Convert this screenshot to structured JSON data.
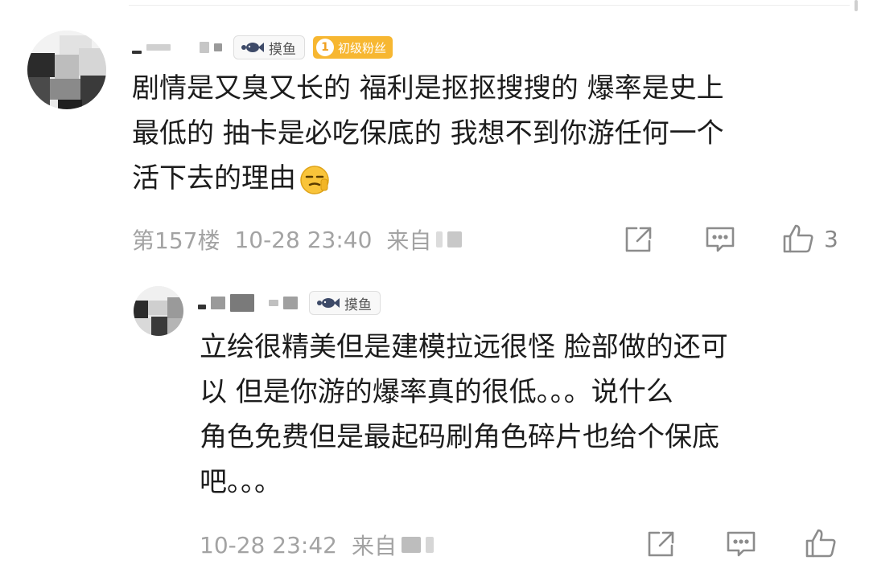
{
  "comments": [
    {
      "badges": {
        "fish_label": "摸鱼",
        "fan_level_icon": "1",
        "fan_label": "初级粉丝"
      },
      "text_lines": [
        "剧情是又臭又长的 福利是抠抠搜搜的 爆率是史上",
        "最低的 抽卡是必吃保底的 我想不到你游任何一个",
        "活下去的理由"
      ],
      "emoji": "squinting-face-emoji",
      "floor": "第157楼",
      "time": "10-28 23:40",
      "from_label": "来自",
      "like_count": "3"
    },
    {
      "badges": {
        "fish_label": "摸鱼"
      },
      "text_lines": [
        "立绘很精美但是建模拉远很怪 脸部做的还可",
        "以 但是你游的爆率真的很低。。。说什么",
        "角色免费但是最起码刷角色碎片也给个保底",
        "吧。。。"
      ],
      "time": "10-28 23:42",
      "from_label": "来自"
    }
  ],
  "icons": {
    "share": "share-icon",
    "reply": "comment-icon",
    "like": "thumb-up-icon",
    "fish": "fish-icon"
  },
  "colors": {
    "meta_text": "#a3a3a3",
    "fan_badge": "#f7b731",
    "text": "#1c1c1c"
  }
}
